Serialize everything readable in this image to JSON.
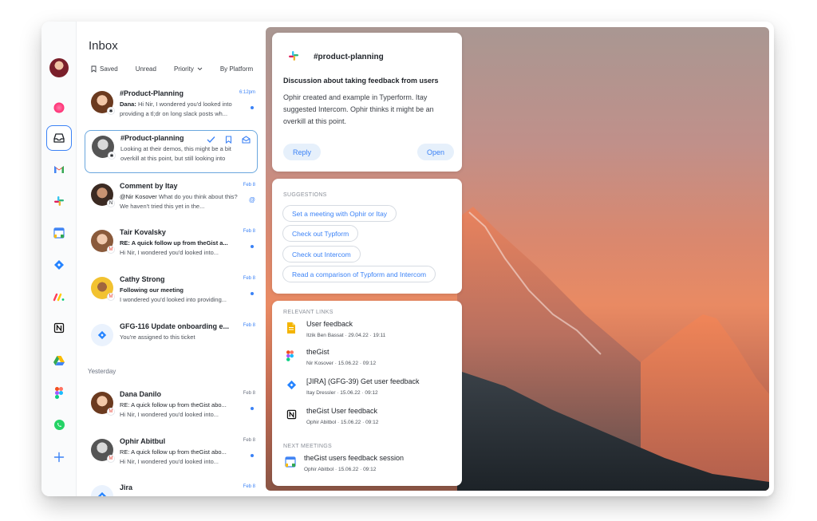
{
  "window": {
    "traffic_colors": [
      "#f25f58",
      "#fbbe2e",
      "#38c84a"
    ]
  },
  "rail": {
    "items": [
      {
        "name": "avatar-profile"
      },
      {
        "name": "gist-icon",
        "color": "#ff2d73"
      },
      {
        "name": "inbox-icon"
      },
      {
        "name": "gmail-icon"
      },
      {
        "name": "slack-icon"
      },
      {
        "name": "google-calendar-icon"
      },
      {
        "name": "jira-icon"
      },
      {
        "name": "monday-icon"
      },
      {
        "name": "notion-icon"
      },
      {
        "name": "google-drive-icon"
      },
      {
        "name": "figma-icon"
      },
      {
        "name": "whatsapp-icon"
      },
      {
        "name": "add-icon"
      }
    ]
  },
  "inbox": {
    "title": "Inbox",
    "filters": [
      "Saved",
      "Unread",
      "Priority",
      "By Platform"
    ],
    "section_yesterday": "Yesterday",
    "messages": [
      {
        "title": "#Product-Planning",
        "sender": "Dana:",
        "preview": "Hi Nir, I wondered you'd looked into providing a tl;dr on long slack posts wh...",
        "date": "6:12pm",
        "source": "slack"
      },
      {
        "title": "#Product-planning",
        "sender": "",
        "preview": "Looking at their demos, this might be a bit overkill at this point, but still looking into",
        "date": "",
        "source": "slack"
      },
      {
        "title": "Comment by Itay",
        "sender": "@Nir Kosover",
        "preview": "What do you think about this? We haven't tried this yet in the...",
        "date": "Feb 8",
        "source": "notion"
      },
      {
        "title": "Tair Kovalsky",
        "sender": "RE: A quick follow up from theGist a...",
        "preview": "Hi Nir, I wondered you'd looked into...",
        "date": "Feb 8",
        "source": "gmail"
      },
      {
        "title": "Cathy Strong",
        "sender": "Following our meeting",
        "preview": "I wondered you'd looked into providing...",
        "date": "Feb 8",
        "source": "gmail"
      },
      {
        "title": "GFG-116 Update onboarding e...",
        "sender": "",
        "preview": "You're assigned to this ticket",
        "date": "Feb 8",
        "source": "jira"
      },
      {
        "title": "Dana Danilo",
        "sender": "RE: A quick follow up from theGist abo...",
        "preview": "Hi Nir, I wondered you'd looked into...",
        "date": "Feb 8",
        "source": "gmail"
      },
      {
        "title": "Ophir Abitbul",
        "sender": "RE: A quick follow up from theGist abo...",
        "preview": "Hi Nir, I wondered you'd looked into...",
        "date": "Feb 8",
        "source": "gmail"
      },
      {
        "title": "Jira",
        "sender": "",
        "preview": "",
        "date": "Feb 8",
        "source": "jira"
      }
    ]
  },
  "detail": {
    "channel": "#product-planning",
    "heading": "Discussion about taking feedback from users",
    "body": "Ophir created and example in  Typerform. Itay suggested Intercom. Ophir thinks it might be an overkill at this point.",
    "reply_label": "Reply",
    "open_label": "Open"
  },
  "suggestions": {
    "label": "SUGGESTIONS",
    "items": [
      "Set a meeting with Ophir or Itay",
      "Check out Typform",
      "Check out Intercom",
      "Read a comparison of Typform and Intercom"
    ]
  },
  "links": {
    "label": "RELEVANT LINKS",
    "items": [
      {
        "title": "User feedback",
        "meta": "Itzik Ben Bassat · 29.04.22 · 19:11",
        "icon": "google-docs-icon"
      },
      {
        "title": "theGist",
        "meta": "Nir Kosover · 15.06.22 · 09:12",
        "icon": "figma-icon"
      },
      {
        "title": "[JIRA] (GFG-39) Get user feedback",
        "meta": "Itay Dressler · 15.06.22 · 09:12",
        "icon": "jira-icon"
      },
      {
        "title": "theGist User feedback",
        "meta": "Ophir Abitbol · 15.06.22 · 09:12",
        "icon": "notion-icon"
      }
    ]
  },
  "meetings": {
    "label": "NEXT MEETINGS",
    "items": [
      {
        "title": "theGist users feedback session",
        "meta": "Ophir Abitbol · 15.06.22 · 09:12",
        "icon": "google-calendar-icon"
      }
    ]
  }
}
